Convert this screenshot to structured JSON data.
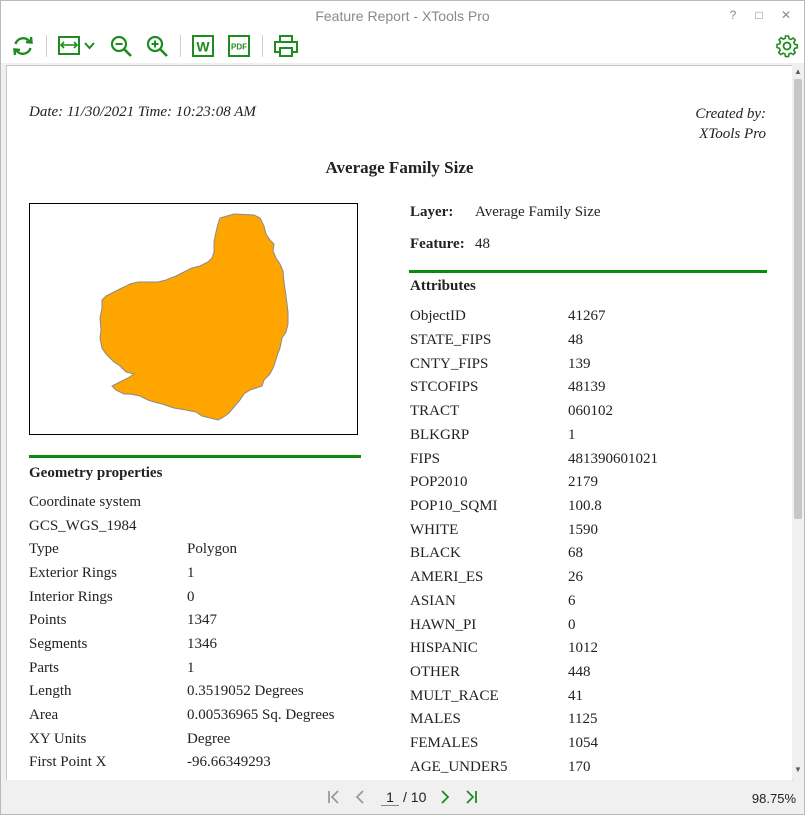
{
  "window": {
    "title": "Feature Report - XTools Pro",
    "help_label": "?",
    "maximize_label": "□",
    "close_label": "✕"
  },
  "toolbar": {
    "icons": [
      "refresh-icon",
      "page-width-icon",
      "zoom-out-icon",
      "zoom-in-icon",
      "word-export-icon",
      "pdf-export-icon",
      "print-icon",
      "settings-icon"
    ],
    "word_label": "W",
    "pdf_label": "PDF",
    "accent_color": "#1e8c1e"
  },
  "report": {
    "date_line": "Date: 11/30/2021 Time: 10:23:08 AM",
    "created_line1": "Created by:",
    "created_line2": "XTools Pro",
    "title": "Average Family Size",
    "layer_label": "Layer:",
    "layer_value": "Average Family Size",
    "feature_label": "Feature:",
    "feature_value": "48",
    "polygon_color": "#ffa500",
    "rule_color": "#0d8a0d",
    "geometry": {
      "title": "Geometry properties",
      "coord_label": "Coordinate system",
      "coord_value": "GCS_WGS_1984",
      "rows": [
        {
          "k": "Type",
          "v": "Polygon"
        },
        {
          "k": "Exterior Rings",
          "v": "1"
        },
        {
          "k": "Interior Rings",
          "v": "0"
        },
        {
          "k": "Points",
          "v": "1347"
        },
        {
          "k": "Segments",
          "v": "1346"
        },
        {
          "k": "Parts",
          "v": "1"
        },
        {
          "k": "Length",
          "v": "0.3519052 Degrees"
        },
        {
          "k": "Area",
          "v": "0.00536965 Sq. Degrees"
        },
        {
          "k": "XY Units",
          "v": "Degree"
        },
        {
          "k": "First Point X",
          "v": "-96.66349293"
        }
      ]
    },
    "attributes": {
      "title": "Attributes",
      "rows": [
        {
          "k": "ObjectID",
          "v": "41267"
        },
        {
          "k": "STATE_FIPS",
          "v": "48"
        },
        {
          "k": "CNTY_FIPS",
          "v": "139"
        },
        {
          "k": "STCOFIPS",
          "v": "48139"
        },
        {
          "k": "TRACT",
          "v": "060102"
        },
        {
          "k": "BLKGRP",
          "v": "1"
        },
        {
          "k": "FIPS",
          "v": "481390601021"
        },
        {
          "k": "POP2010",
          "v": "2179"
        },
        {
          "k": "POP10_SQMI",
          "v": "100.8"
        },
        {
          "k": "WHITE",
          "v": "1590"
        },
        {
          "k": "BLACK",
          "v": "68"
        },
        {
          "k": "AMERI_ES",
          "v": "26"
        },
        {
          "k": "ASIAN",
          "v": "6"
        },
        {
          "k": "HAWN_PI",
          "v": "0"
        },
        {
          "k": "HISPANIC",
          "v": "1012"
        },
        {
          "k": "OTHER",
          "v": "448"
        },
        {
          "k": "MULT_RACE",
          "v": "41"
        },
        {
          "k": "MALES",
          "v": "1125"
        },
        {
          "k": "FEMALES",
          "v": "1054"
        },
        {
          "k": "AGE_UNDER5",
          "v": "170"
        }
      ]
    }
  },
  "pager": {
    "current_page": "1",
    "total_text": "/ 10",
    "icons": [
      "first-page-icon",
      "prev-page-icon",
      "next-page-icon",
      "last-page-icon"
    ]
  },
  "status": {
    "zoom": "98.75%"
  }
}
